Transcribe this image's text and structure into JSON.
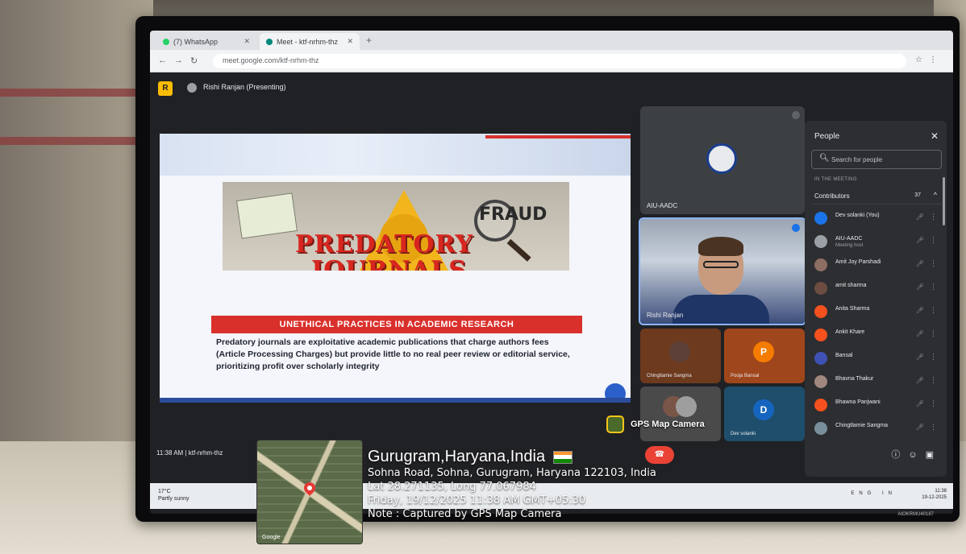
{
  "browser": {
    "tabs": [
      {
        "label": "(7) WhatsApp",
        "active": false,
        "color": "#25d366"
      },
      {
        "label": "Meet - ktf-nrhm-thz",
        "active": true,
        "color": "#00897b"
      }
    ],
    "url": "meet.google.com/ktf-nrhm-thz"
  },
  "meet": {
    "presenter": "Rishi Ranjan (Presenting)",
    "slide": {
      "title_line1": "PREDATORY",
      "title_line2": "JOURNALS",
      "fraud": "FRAUD",
      "band": "UNETHICAL PRACTICES IN ACADEMIC RESEARCH",
      "body": "Predatory journals are exploitative academic publications that charge authors fees (Article Processing Charges) but provide little to no real peer review or editorial service, prioritizing profit over scholarly integrity"
    },
    "tiles": [
      {
        "name": "AIU-AADC"
      },
      {
        "name": "Rishi Ranjan"
      },
      {
        "name": "Chingtlamie Sangma"
      },
      {
        "name": "Pooja Bansal",
        "initial": "P"
      },
      {
        "name": ""
      },
      {
        "name": "Dev solanki",
        "initial": "D"
      }
    ],
    "bottom_time": "11:38 AM  |  ktf-nrhm-thz"
  },
  "people": {
    "title": "People",
    "search_placeholder": "Search for people",
    "in_meeting": "IN THE MEETING",
    "contributors_label": "Contributors",
    "contributors_count": "37",
    "list": [
      {
        "name": "Dev solanki (You)",
        "sub": "",
        "color": "#1a73e8"
      },
      {
        "name": "AIU-AADC",
        "sub": "Meeting host",
        "color": "#9aa0a6"
      },
      {
        "name": "Amit Joy Parshadi",
        "sub": "",
        "color": "#8d6e63"
      },
      {
        "name": "amit sharma",
        "sub": "",
        "color": "#6d4c41"
      },
      {
        "name": "Anita Sharma",
        "sub": "",
        "color": "#f4511e"
      },
      {
        "name": "Ankit Khare",
        "sub": "",
        "color": "#f4511e"
      },
      {
        "name": "Bansal",
        "sub": "",
        "color": "#3f51b5"
      },
      {
        "name": "Bhavna Thakur",
        "sub": "",
        "color": "#a1887f"
      },
      {
        "name": "Bhawna Panjwani",
        "sub": "",
        "color": "#f4511e"
      },
      {
        "name": "Chingtlamie Sangma",
        "sub": "",
        "color": "#78909c"
      }
    ]
  },
  "taskbar": {
    "weather": "17°C\nPartly sunny",
    "lang": "ENG IN",
    "time": "11:38",
    "date": "19-12-2025"
  },
  "monitor_tag": "AIOKRMU40187",
  "gps": {
    "app_name": "GPS Map Camera",
    "city": "Gurugram,Haryana,India",
    "address": "Sohna Road, Sohna, Gurugram, Haryana 122103, India",
    "coords": "Lat 28.271135, Long 77.067984",
    "datetime": "Friday, 19/12/2025 11:38 AM GMT+05:30",
    "note": "Note : Captured by GPS Map Camera",
    "map_label": "Google"
  }
}
